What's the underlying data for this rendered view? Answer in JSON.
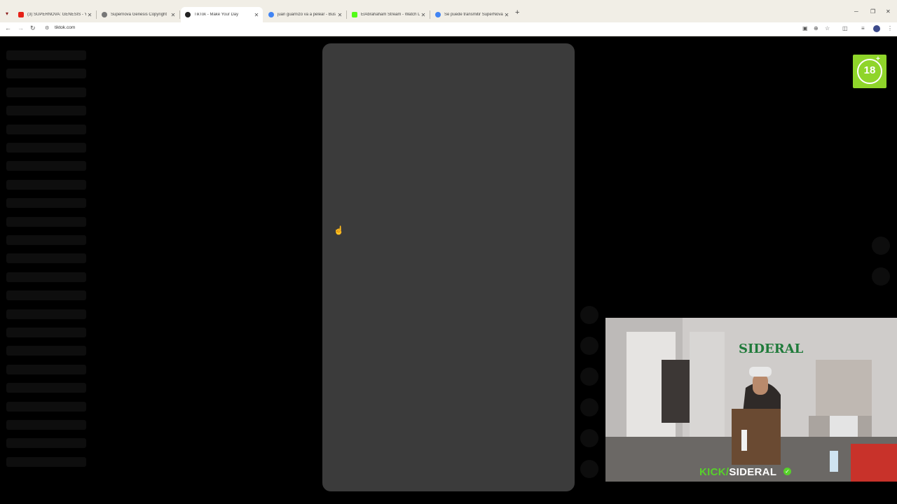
{
  "browser": {
    "tabs": [
      {
        "title": "(3) SUPERNOVA: GENESIS - You",
        "favicon_color": "#e62117"
      },
      {
        "title": "Supernova Genesis Copyright",
        "favicon_color": "#777777"
      },
      {
        "title": "TikTok - Make Your Day",
        "favicon_color": "#222222"
      },
      {
        "title": "juan guarnizo va a pelear - Bus",
        "favicon_color": "#4285f4"
      },
      {
        "title": "ElAbrahaham Stream - Watch L",
        "favicon_color": "#53fc18"
      },
      {
        "title": "Se puede transmitir SuperNova",
        "favicon_color": "#4285f4"
      }
    ],
    "active_tab_index": 2,
    "new_tab_symbol": "+",
    "address": "tiktok.com"
  },
  "page": {
    "age_badge": {
      "label": "18",
      "plus": "+",
      "color": "#8fd52a"
    },
    "skeleton_count": 23,
    "action_circle_count": 6
  },
  "overlay": {
    "webcam_caption_prefix": "KICK/",
    "webcam_caption_name": "SIDERAL",
    "accent_color": "#57d12a"
  }
}
